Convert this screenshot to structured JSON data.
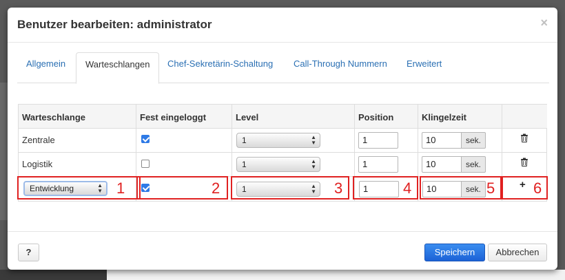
{
  "dialog": {
    "title": "Benutzer bearbeiten: administrator",
    "close_glyph": "×"
  },
  "tabs": [
    {
      "label": "Allgemein",
      "active": false
    },
    {
      "label": "Warteschlangen",
      "active": true
    },
    {
      "label": "Chef-Sekretärin-Schaltung",
      "active": false
    },
    {
      "label": "Call-Through Nummern",
      "active": false
    },
    {
      "label": "Erweitert",
      "active": false
    }
  ],
  "table": {
    "headers": [
      "Warteschlange",
      "Fest eingeloggt",
      "Level",
      "Position",
      "Klingelzeit",
      ""
    ],
    "rows": [
      {
        "queue": "Zentrale",
        "logged_in": true,
        "level": "1",
        "position": "1",
        "ring_time": "10",
        "ring_unit": "sek.",
        "action_icon": "trash-icon"
      },
      {
        "queue": "Logistik",
        "logged_in": false,
        "level": "1",
        "position": "1",
        "ring_time": "10",
        "ring_unit": "sek.",
        "action_icon": "trash-icon"
      }
    ],
    "new_row": {
      "queue_select": "Entwicklung",
      "logged_in": true,
      "level": "1",
      "position": "1",
      "ring_time": "10",
      "ring_unit": "sek.",
      "action_icon": "plus-icon",
      "action_glyph": "+"
    }
  },
  "annotations": [
    "1",
    "2",
    "3",
    "4",
    "5",
    "6"
  ],
  "annotation_color": "#e02020",
  "footer": {
    "help_label": "?",
    "save_label": "Speichern",
    "cancel_label": "Abbrechen"
  },
  "colors": {
    "link": "#2a6fb3",
    "primary": "#1c62d6",
    "checkbox_on": "#2e7ae6"
  }
}
